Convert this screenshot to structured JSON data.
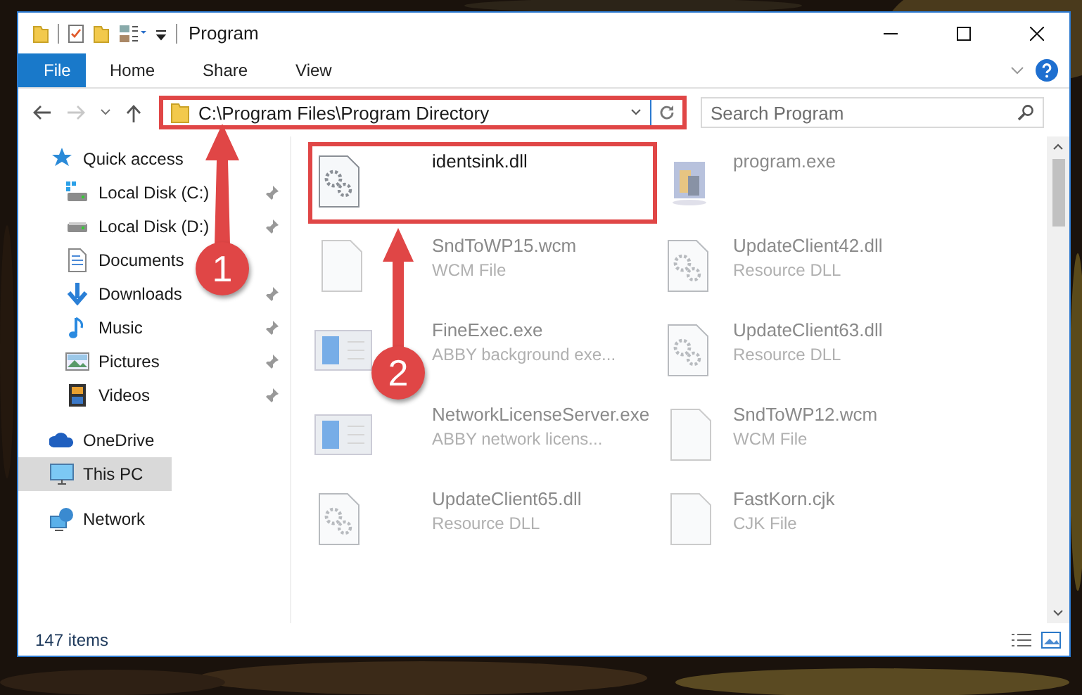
{
  "window": {
    "title": "Program"
  },
  "ribbon": {
    "tabs": [
      {
        "label": "File",
        "selected": true
      },
      {
        "label": "Home",
        "selected": false
      },
      {
        "label": "Share",
        "selected": false
      },
      {
        "label": "View",
        "selected": false
      }
    ]
  },
  "address": {
    "path": "C:\\Program Files\\Program Directory",
    "highlighted": true
  },
  "search": {
    "placeholder": "Search Program"
  },
  "navigation": [
    {
      "label": "Quick access",
      "kind": "star",
      "selected": false,
      "children": [
        {
          "label": "Local Disk (C:)",
          "kind": "disk-win",
          "pinned": true,
          "selected": false
        },
        {
          "label": "Local Disk (D:)",
          "kind": "disk",
          "pinned": true,
          "selected": false
        },
        {
          "label": "Documents",
          "kind": "document",
          "pinned": false,
          "selected": false
        },
        {
          "label": "Downloads",
          "kind": "download",
          "pinned": true,
          "selected": false
        },
        {
          "label": "Music",
          "kind": "music",
          "pinned": true,
          "selected": false
        },
        {
          "label": "Pictures",
          "kind": "pictures",
          "pinned": true,
          "selected": false
        },
        {
          "label": "Videos",
          "kind": "videos",
          "pinned": true,
          "selected": false
        }
      ]
    },
    {
      "label": "OneDrive",
      "kind": "cloud",
      "selected": false
    },
    {
      "label": "This PC",
      "kind": "pc",
      "selected": true
    },
    {
      "label": "Network",
      "kind": "network",
      "selected": false
    }
  ],
  "files": [
    {
      "name": "identsink.dll",
      "kind": "gears",
      "blurred": false,
      "highlighted": true
    },
    {
      "name": "program.exe",
      "kind": "app",
      "blurred": true,
      "highlighted": false
    },
    {
      "name": "SndToWP15.wcm",
      "type": "WCM File",
      "kind": "blank",
      "blurred": true,
      "highlighted": false
    },
    {
      "name": "UpdateClient42.dll",
      "type": "Resource DLL",
      "kind": "gears",
      "blurred": true,
      "highlighted": false
    },
    {
      "name": "FineExec.exe",
      "type": "ABBY background exe...",
      "kind": "window",
      "blurred": true,
      "highlighted": false
    },
    {
      "name": "UpdateClient63.dll",
      "type": "Resource DLL",
      "kind": "gears",
      "blurred": true,
      "highlighted": false
    },
    {
      "name": "NetworkLicenseServer.exe",
      "type": "ABBY network licens...",
      "kind": "window",
      "blurred": true,
      "highlighted": false
    },
    {
      "name": "SndToWP12.wcm",
      "type": "WCM File",
      "kind": "blank",
      "blurred": true,
      "highlighted": false
    },
    {
      "name": "UpdateClient65.dll",
      "type": "Resource DLL",
      "kind": "gears",
      "blurred": true,
      "highlighted": false
    },
    {
      "name": "FastKorn.cjk",
      "type": "CJK File",
      "kind": "blank",
      "blurred": true,
      "highlighted": false
    }
  ],
  "status_bar": {
    "count": "147 items"
  },
  "annotations": [
    {
      "number": "1",
      "kind": "slanted"
    },
    {
      "number": "2",
      "kind": "straight"
    }
  ]
}
